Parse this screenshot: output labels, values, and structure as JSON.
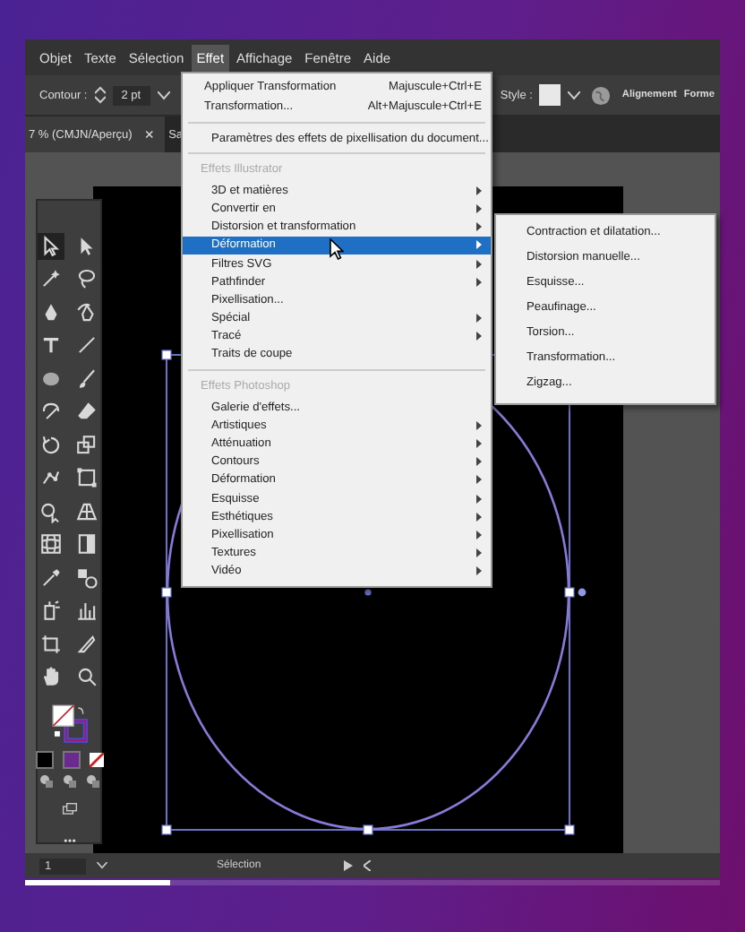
{
  "menu_bar": {
    "items": [
      {
        "label": "Objet",
        "selected": false
      },
      {
        "label": "Texte",
        "selected": false
      },
      {
        "label": "Sélection",
        "selected": false
      },
      {
        "label": "Effet",
        "selected": true
      },
      {
        "label": "Affichage",
        "selected": false
      },
      {
        "label": "Fenêtre",
        "selected": false
      },
      {
        "label": "Aide",
        "selected": false
      }
    ]
  },
  "control_bar": {
    "stroke_label": "Contour :",
    "stroke_value": "2 pt",
    "style_label": "Style :",
    "links": [
      "Alignement",
      "Forme"
    ]
  },
  "document_tabs": [
    {
      "label": "7 % (CMJN/Aperçu)",
      "close": "×",
      "selected": true
    },
    {
      "label": "Sa",
      "selected": false
    }
  ],
  "effect_menu": {
    "items": [
      {
        "kind": "item",
        "label": "Appliquer Transformation",
        "shortcut": "Majuscule+Ctrl+E",
        "submenu": false,
        "selected": false
      },
      {
        "kind": "item",
        "label": "Transformation...",
        "shortcut": "Alt+Majuscule+Ctrl+E",
        "submenu": false,
        "selected": false
      },
      {
        "kind": "separator"
      },
      {
        "kind": "item",
        "label": "Paramètres des effets de pixellisation du document...",
        "submenu": false,
        "selected": false
      },
      {
        "kind": "separator"
      },
      {
        "kind": "header",
        "label": "Effets Illustrator"
      },
      {
        "kind": "item",
        "label": "3D et matières",
        "submenu": true,
        "selected": false
      },
      {
        "kind": "item",
        "label": "Convertir en",
        "submenu": true,
        "selected": false
      },
      {
        "kind": "item",
        "label": "Distorsion et transformation",
        "submenu": true,
        "selected": false
      },
      {
        "kind": "item",
        "label": "Déformation",
        "submenu": true,
        "selected": true
      },
      {
        "kind": "item",
        "label": "Filtres SVG",
        "submenu": true,
        "selected": false
      },
      {
        "kind": "item",
        "label": "Pathfinder",
        "submenu": true,
        "selected": false
      },
      {
        "kind": "item",
        "label": "Pixellisation...",
        "submenu": false,
        "selected": false
      },
      {
        "kind": "item",
        "label": "Spécial",
        "submenu": true,
        "selected": false
      },
      {
        "kind": "item",
        "label": "Tracé",
        "submenu": true,
        "selected": false
      },
      {
        "kind": "item",
        "label": "Traits de coupe",
        "submenu": false,
        "selected": false
      },
      {
        "kind": "separator"
      },
      {
        "kind": "header",
        "label": "Effets Photoshop"
      },
      {
        "kind": "item",
        "label": "Galerie d'effets...",
        "submenu": false,
        "selected": false
      },
      {
        "kind": "item",
        "label": "Artistiques",
        "submenu": true,
        "selected": false
      },
      {
        "kind": "item",
        "label": "Atténuation",
        "submenu": true,
        "selected": false
      },
      {
        "kind": "item",
        "label": "Contours",
        "submenu": true,
        "selected": false
      },
      {
        "kind": "item",
        "label": "Déformation",
        "submenu": true,
        "selected": false
      },
      {
        "kind": "item",
        "label": "Esquisse",
        "submenu": true,
        "selected": false
      },
      {
        "kind": "item",
        "label": "Esthétiques",
        "submenu": true,
        "selected": false
      },
      {
        "kind": "item",
        "label": "Pixellisation",
        "submenu": true,
        "selected": false
      },
      {
        "kind": "item",
        "label": "Textures",
        "submenu": true,
        "selected": false
      },
      {
        "kind": "item",
        "label": "Vidéo",
        "submenu": true,
        "selected": false
      }
    ]
  },
  "submenu": {
    "items": [
      "Contraction et dilatation...",
      "Distorsion manuelle...",
      "Esquisse...",
      "Peaufinage...",
      "Torsion...",
      "Transformation...",
      "Zigzag..."
    ]
  },
  "status_bar": {
    "zoom": "1",
    "tool": "Sélection"
  },
  "video_progress": {
    "level": 0.21
  }
}
